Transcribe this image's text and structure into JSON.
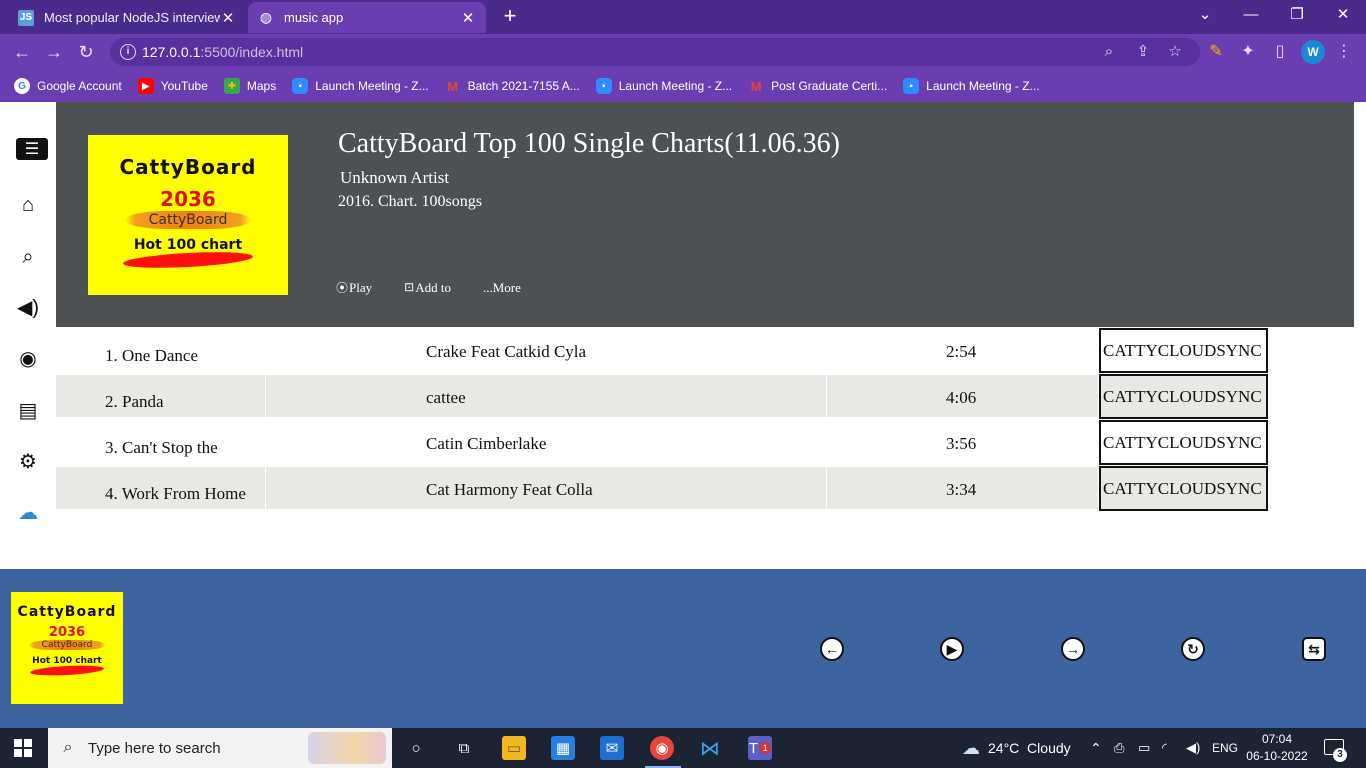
{
  "browser": {
    "tabs": [
      {
        "title": "Most popular NodeJS interview q",
        "favicon": "js-doc-icon"
      },
      {
        "title": "music app",
        "favicon": "globe-icon"
      }
    ],
    "url_host": "127.0.0.1",
    "url_rest": ":5500/index.html",
    "profile_initial": "W",
    "bookmarks": [
      {
        "label": "Google Account",
        "icon": "google-icon"
      },
      {
        "label": "YouTube",
        "icon": "youtube-icon"
      },
      {
        "label": "Maps",
        "icon": "maps-icon"
      },
      {
        "label": "Launch Meeting - Z...",
        "icon": "zoom-icon"
      },
      {
        "label": "Batch 2021-7155 A...",
        "icon": "gmail-icon"
      },
      {
        "label": "Launch Meeting - Z...",
        "icon": "zoom-icon"
      },
      {
        "label": "Post Graduate Certi...",
        "icon": "gmail-icon"
      },
      {
        "label": "Launch Meeting - Z...",
        "icon": "zoom-icon"
      }
    ]
  },
  "album": {
    "cover": {
      "brand": "CattyBoard",
      "year": "2036",
      "sub": "CattyBoard",
      "tagline": "Hot 100 chart"
    },
    "title": "CattyBoard Top 100 Single Charts(11.06.36)",
    "artist": "Unknown Artist",
    "meta": "2016. Chart. 100songs",
    "actions": {
      "play": "Play",
      "add": "Add to",
      "more": "...More"
    }
  },
  "tracks": [
    {
      "name": "1. One Dance",
      "artist": "Crake Feat Catkid Cyla",
      "duration": "2:54",
      "source": "CATTYCLOUDSYNC"
    },
    {
      "name": "2. Panda",
      "artist": "cattee",
      "duration": "4:06",
      "source": "CATTYCLOUDSYNC"
    },
    {
      "name": "3. Can't Stop the",
      "artist": "Catin Cimberlake",
      "duration": "3:56",
      "source": "CATTYCLOUDSYNC"
    },
    {
      "name": "4. Work From Home",
      "artist": "Cat Harmony Feat Colla",
      "duration": "3:34",
      "source": "CATTYCLOUDSYNC"
    }
  ],
  "colors": {
    "hero_bg": "#4d5154",
    "player_bg": "#3d64a0",
    "cover_bg": "#ffff00",
    "browser_accent": "#6a3eb0"
  },
  "taskbar": {
    "search_placeholder": "Type here to search",
    "weather": "24°C  Cloudy",
    "language": "ENG",
    "time": "07:04",
    "date": "06-10-2022",
    "notifications": "3",
    "teams_badge": "1"
  }
}
